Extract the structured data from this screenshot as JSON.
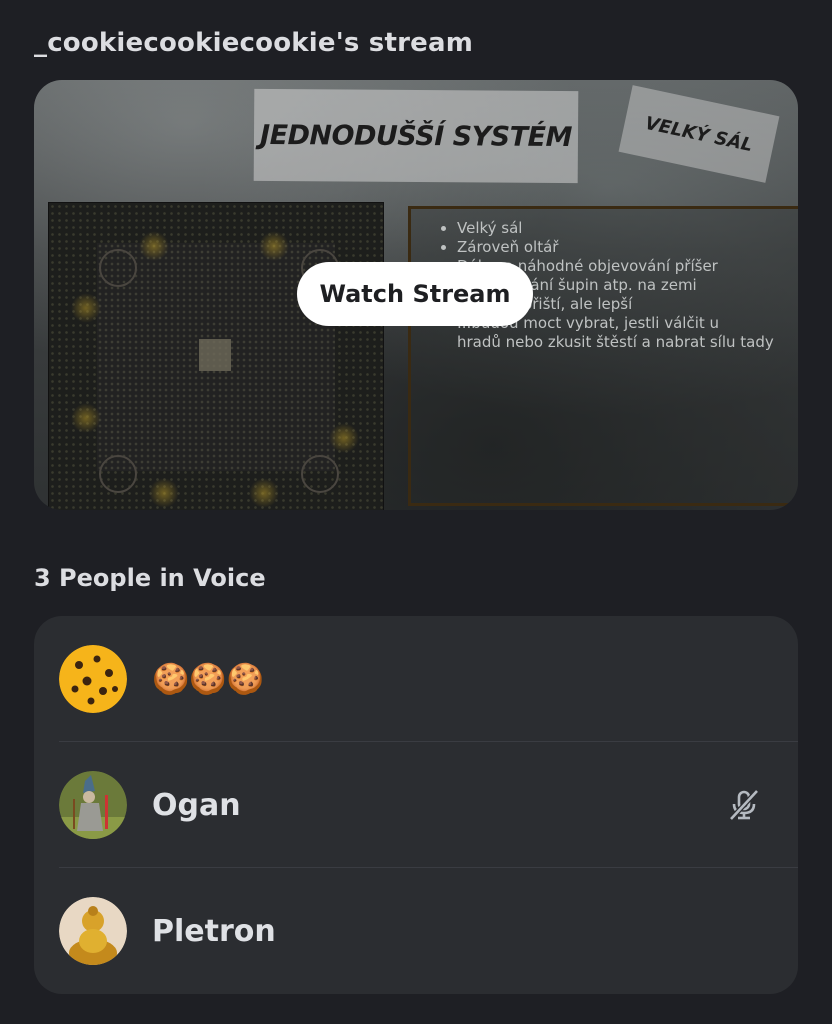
{
  "stream": {
    "title": "_cookiecookiecookie's stream",
    "watch_label": "Watch Stream",
    "slide_title": "JEDNODUŠŠÍ SYSTÉM",
    "slide_tag": "VELKÝ SÁL",
    "slide_bullets": [
      "Velký sál",
      "Zároveň oltář",
      "Dále se náhodné objevování příšer",
      "...objevování šupin atp. na zemi",
      "...ebné obřiští, ale lepší",
      "...budou moct vybrat, jestli válčit u",
      "hradů nebo zkusit štěstí a nabrat sílu tady"
    ]
  },
  "voice": {
    "heading": "3 People in Voice",
    "members": [
      {
        "name": "🍪🍪🍪",
        "avatar": "cookie-avatar",
        "muted": false
      },
      {
        "name": "Ogan",
        "avatar": "wizard-avatar",
        "muted": true
      },
      {
        "name": "Pletron",
        "avatar": "golden-figure-avatar",
        "muted": false
      }
    ]
  },
  "colors": {
    "background": "#1e1f24",
    "panel": "#2b2d31",
    "text": "#dfe1e5",
    "button": "#ffffff"
  }
}
